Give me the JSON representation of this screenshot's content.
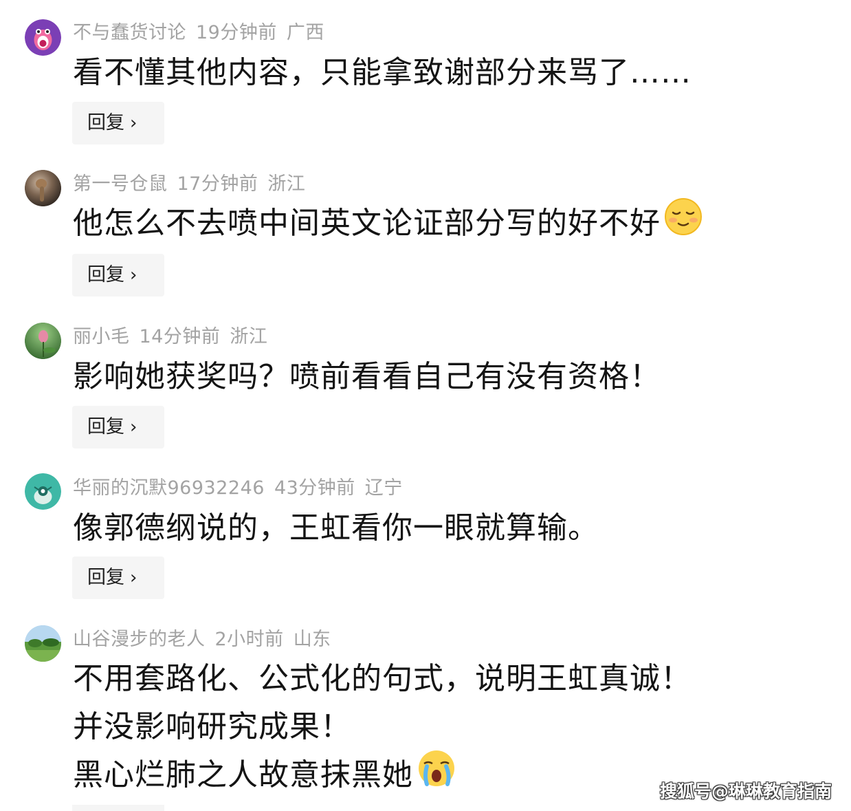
{
  "comments": [
    {
      "user": "不与蠢货讨论",
      "time": "19分钟前",
      "region": "广西",
      "lines": [
        "看不懂其他内容，只能拿致谢部分来骂了……"
      ],
      "reply_label": "回复"
    },
    {
      "user": "第一号仓鼠",
      "time": "17分钟前",
      "region": "浙江",
      "lines": [
        "他怎么不去喷中间英文论证部分写的好不好"
      ],
      "emoji": "relieved-face-icon",
      "reply_label": "回复"
    },
    {
      "user": "丽小毛",
      "time": "14分钟前",
      "region": "浙江",
      "lines": [
        "影响她获奖吗？喷前看看自己有没有资格！"
      ],
      "reply_label": "回复"
    },
    {
      "user": "华丽的沉默96932246",
      "time": "43分钟前",
      "region": "辽宁",
      "lines": [
        "像郭德纲说的，王虹看你一眼就算输。"
      ],
      "reply_label": "回复"
    },
    {
      "user": "山谷漫步的老人",
      "time": "2小时前",
      "region": "山东",
      "lines": [
        "不用套路化、公式化的句式，说明王虹真诚！",
        "并没影响研究成果！",
        "黑心烂肺之人故意抹黑她"
      ],
      "emoji": "crying-face-icon"
    }
  ],
  "watermark": "搜狐号@琳琳教育指南",
  "colors": {
    "meta_text": "#a3a3a3",
    "body_text": "#141414",
    "reply_bg": "#f5f5f5"
  }
}
